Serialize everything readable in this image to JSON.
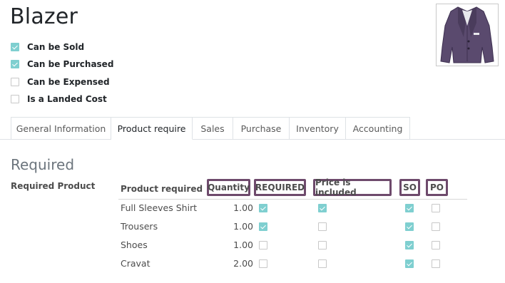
{
  "product": {
    "name": "Blazer",
    "image_icon": "blazer-image"
  },
  "flags": [
    {
      "label": "Can be Sold",
      "checked": true
    },
    {
      "label": "Can be Purchased",
      "checked": true
    },
    {
      "label": "Can be Expensed",
      "checked": false
    },
    {
      "label": "Is a Landed Cost",
      "checked": false
    }
  ],
  "tabs": [
    {
      "label": "General Information",
      "active": false
    },
    {
      "label": "Product require",
      "active": true
    },
    {
      "label": "Sales",
      "active": false
    },
    {
      "label": "Purchase",
      "active": false
    },
    {
      "label": "Inventory",
      "active": false
    },
    {
      "label": "Accounting",
      "active": false
    }
  ],
  "section": {
    "title": "Required",
    "field_label": "Required Product"
  },
  "table": {
    "columns": {
      "product": "Product required",
      "quantity": "Quantity",
      "required": "REQUIRED",
      "price_included": "Price is included",
      "so": "SO",
      "po": "PO"
    },
    "rows": [
      {
        "product": "Full Sleeves Shirt",
        "quantity": "1.00",
        "required": true,
        "price_included": true,
        "so": true,
        "po": false
      },
      {
        "product": "Trousers",
        "quantity": "1.00",
        "required": true,
        "price_included": false,
        "so": true,
        "po": false
      },
      {
        "product": "Shoes",
        "quantity": "1.00",
        "required": false,
        "price_included": false,
        "so": true,
        "po": false
      },
      {
        "product": "Cravat",
        "quantity": "2.00",
        "required": false,
        "price_included": false,
        "so": true,
        "po": false
      }
    ]
  },
  "colors": {
    "checkbox_checked": "#7fcfd0",
    "highlight_border": "#6e4a6c",
    "blazer": "#5a4a6e"
  }
}
